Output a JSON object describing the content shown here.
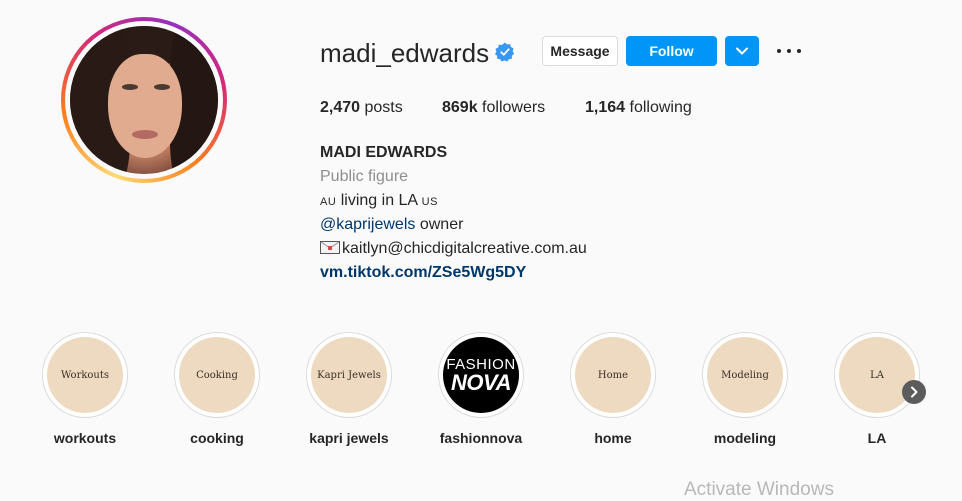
{
  "profile": {
    "username": "madi_edwards",
    "verified": true,
    "buttons": {
      "message": "Message",
      "follow": "Follow"
    },
    "stats": {
      "posts_count": "2,470",
      "posts_label": "posts",
      "followers_count": "869k",
      "followers_label": "followers",
      "following_count": "1,164",
      "following_label": "following"
    },
    "bio": {
      "name": "MADI EDWARDS",
      "category": "Public figure",
      "line1_flag_a": "AU",
      "line1_text": " living in LA ",
      "line1_flag_b": "US",
      "mention": "@kaprijewels",
      "mention_suffix": " owner",
      "email": "kaitlyn@chicdigitalcreative.com.au",
      "link": "vm.tiktok.com/ZSe5Wg5DY"
    }
  },
  "highlights": [
    {
      "cover_text": "Workouts",
      "label": "workouts"
    },
    {
      "cover_text": "Cooking",
      "label": "cooking"
    },
    {
      "cover_text": "Kapri Jewels",
      "label": "kapri jewels"
    },
    {
      "cover_text_top": "FASHION",
      "cover_text_bottom": "NOVA",
      "label": "fashionnova"
    },
    {
      "cover_text": "Home",
      "label": "home"
    },
    {
      "cover_text": "Modeling",
      "label": "modeling"
    },
    {
      "cover_text": "LA",
      "label": "LA"
    }
  ],
  "watermark": "Activate Windows",
  "colors": {
    "accent": "#0095f6",
    "link": "#00376b",
    "highlight_bg": "#eedac0"
  }
}
